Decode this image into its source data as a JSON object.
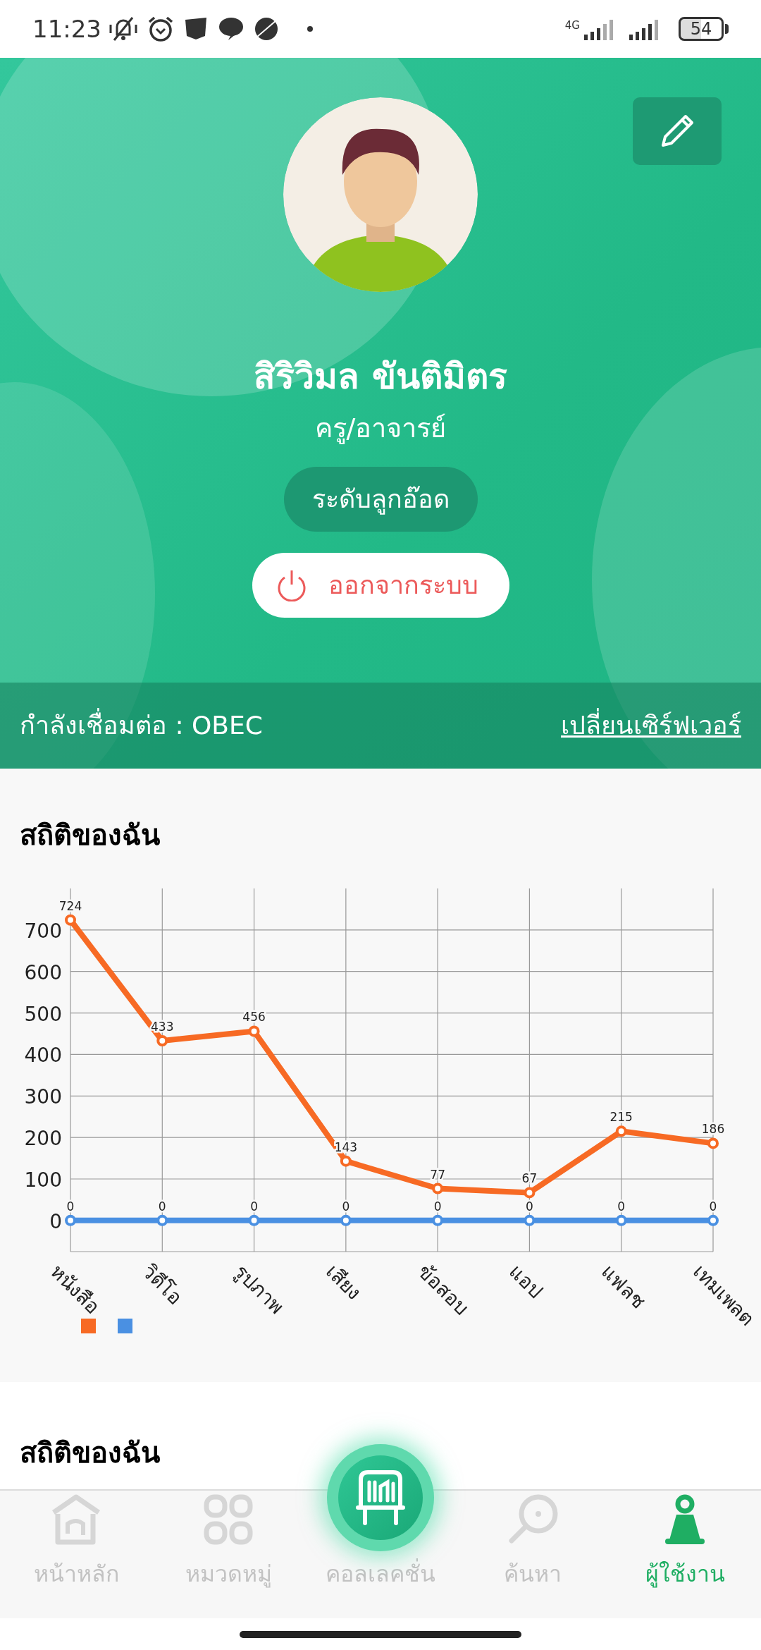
{
  "status_bar": {
    "time": "11:23",
    "network": "4G",
    "battery": "54"
  },
  "profile": {
    "name": "สิริวิมล ขันติมิตร",
    "role": "ครู/อาจารย์",
    "level_badge": "ระดับลูกอ๊อด",
    "logout_button": "ออกจากระบบ"
  },
  "connection": {
    "label": "กำลังเชื่อมต่อ : OBEC",
    "change_server_link": "เปลี่ยนเซิร์ฟเวอร์"
  },
  "stats_card": {
    "title": "สถิติของฉัน",
    "chart_data": {
      "type": "line",
      "categories": [
        "หนังสือ",
        "วิดีโอ",
        "รูปภาพ",
        "เสียง",
        "ข้อสอบ",
        "แอป",
        "แฟลช",
        "เทมเพลต"
      ],
      "series": [
        {
          "color": "#f76a24",
          "marker": true,
          "values": [
            724,
            433,
            456,
            143,
            77,
            67,
            215,
            186
          ]
        },
        {
          "color": "#4a90e2",
          "marker": true,
          "values": [
            0,
            0,
            0,
            0,
            0,
            0,
            0,
            0
          ]
        }
      ],
      "ylim": [
        -75,
        800
      ],
      "yticks": [
        0,
        100,
        200,
        300,
        400,
        500,
        600,
        700
      ],
      "grid": true,
      "data_labels": true
    }
  },
  "stats_card_2": {
    "title": "สถิติของฉัน"
  },
  "bottom_nav": [
    {
      "kind": "tab",
      "label": "หน้าหลัก",
      "selected": false
    },
    {
      "kind": "tab",
      "label": "หมวดหมู่",
      "selected": false
    },
    {
      "kind": "fab",
      "label": "คอลเลคชั่น",
      "selected": false
    },
    {
      "kind": "tab",
      "label": "ค้นหา",
      "selected": false
    },
    {
      "kind": "tab",
      "label": "ผู้ใช้งาน",
      "selected": true
    }
  ]
}
